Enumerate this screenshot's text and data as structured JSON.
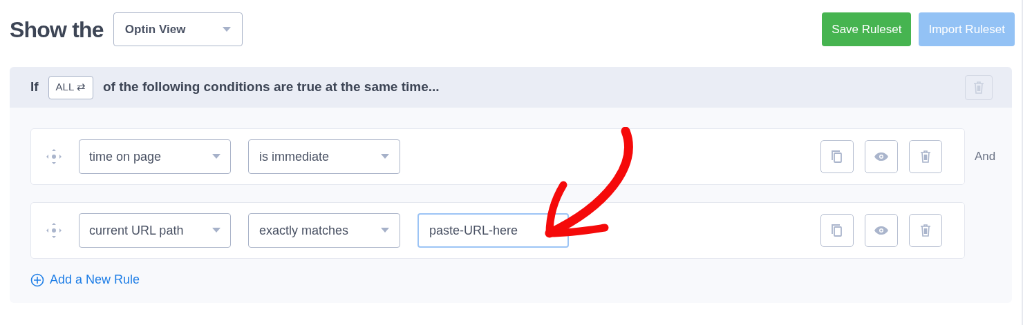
{
  "header": {
    "title": "Show the",
    "view_select": "Optin View"
  },
  "actions": [
    {
      "label": "Save Ruleset",
      "kind": "primary",
      "disabled": false
    },
    {
      "label": "Import Ruleset",
      "kind": "secondary",
      "disabled": true
    }
  ],
  "condition": {
    "prefix": "If",
    "match": "ALL ⇄",
    "suffix": "of the following conditions are true at the same time..."
  },
  "rules": [
    {
      "field": "time on page",
      "operator": "is immediate",
      "connector": "And"
    },
    {
      "field": "current URL path",
      "operator": "exactly matches",
      "value": "paste-URL-here",
      "focused": true
    }
  ],
  "add_rule": "Add a New Rule"
}
